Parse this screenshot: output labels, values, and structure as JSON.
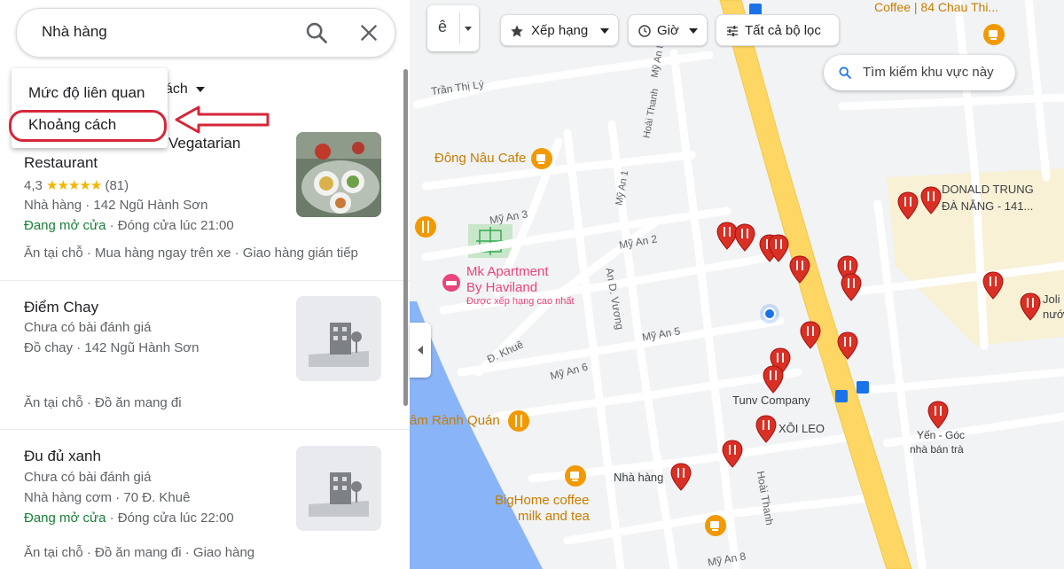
{
  "search": {
    "query": "Nhà hàng"
  },
  "sort": {
    "current_label": "ách",
    "options": [
      "Mức độ liên quan",
      "Khoảng cách"
    ]
  },
  "results": [
    {
      "title_top": "Vegatarian",
      "title": "Restaurant",
      "rating": "4,3",
      "stars": "★★★★★",
      "reviews": "(81)",
      "category_address": "Nhà hàng · 142 Ngũ Hành Sơn",
      "status": "Đang mở cửa",
      "hours": " · Đóng cửa lúc 21:00",
      "services": "Ăn tại chỗ · Mua hàng ngay trên xe · Giao hàng gián tiếp"
    },
    {
      "title": "Điểm Chay",
      "reviews_note": "Chưa có bài đánh giá",
      "category_address": "Đồ chay · 142 Ngũ Hành Sơn",
      "services": "Ăn tại chỗ · Đồ ăn mang đi"
    },
    {
      "title": "Đu đủ xanh",
      "reviews_note": "Chưa có bài đánh giá",
      "category_address": "Nhà hàng cơm · 70 Đ. Khuê",
      "status": "Đang mở cửa",
      "hours": " · Đóng cửa lúc 22:00",
      "services": "Ăn tại chỗ · Đồ ăn mang đi · Giao hàng"
    }
  ],
  "filters": {
    "layer_glyph": "ê",
    "rating": "Xếp hạng",
    "hours": "Giờ",
    "all": "Tất cả bộ lọc",
    "search_area": "Tìm kiếm khu vực này"
  },
  "map_labels": {
    "top_right": "Coffee | 84 Chau Thi...",
    "tran_thi_ly": "Trần Thị Lý",
    "my_an_8": "Mỹ An 8",
    "hoai_thanh": "Hoài Thanh",
    "dong_nau": "Đông Nâu Cafe",
    "my_an_3": "Mỹ An 3",
    "my_an_1": "Mỹ An 1",
    "my_an_2": "Mỹ An 2",
    "donald_1": "DONALD TRUNG",
    "donald_2": "ĐÀ NẴNG -  141...",
    "mk_1": "Mk Apartment",
    "mk_2": "By Haviland",
    "mk_3": "Được xếp hạng cao nhất",
    "an_d_vuong": "An D. Vương",
    "d_khue": "Đ. Khuê",
    "my_an_5": "Mỹ An 5",
    "my_an_6": "Mỹ An 6",
    "joli_1": "Joli",
    "joli_2": "nướ",
    "tunv": "Tunv Company",
    "xoi_leo": "XÔI LEO",
    "yen_1": "Yến - Góc",
    "yen_2": "nhà bán trà",
    "ram_ranh": "âm Rành Quán",
    "nha_hang": "Nhà hàng",
    "bighome_1": "BigHome coffee",
    "bighome_2": "milk and tea",
    "hoai_thanh_2": "Hoài Thanh",
    "my_an_bottom": "Mỹ An 8"
  },
  "colors": {
    "accent_blue": "#1a73e8",
    "open_green": "#188038",
    "pin_red": "#d93025",
    "cafe_orange": "#f29900",
    "annotation_red": "#d6263a",
    "road_yellow": "#fdd663",
    "water_blue": "#8ab4f8"
  }
}
